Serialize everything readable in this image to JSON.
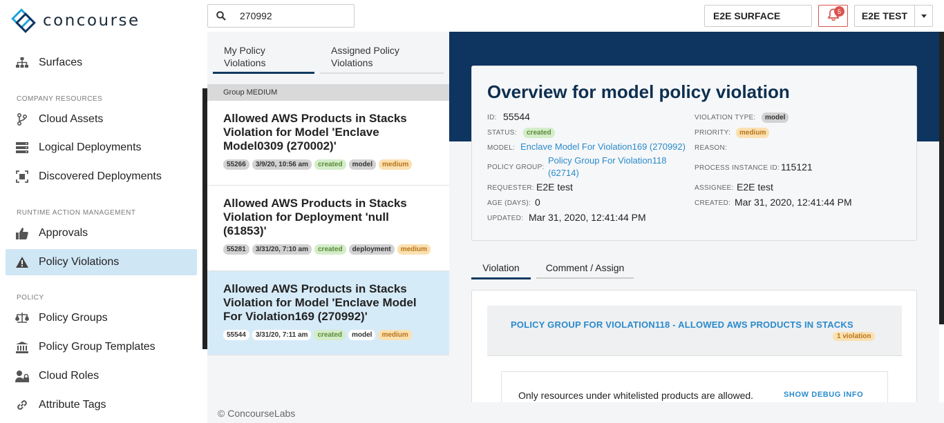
{
  "brand": {
    "name": "concourse"
  },
  "search": {
    "value": "270992",
    "icon": "search-icon"
  },
  "header": {
    "surface": "E2E SURFACE",
    "notifications": {
      "count": "5",
      "icon": "bell-icon"
    },
    "user": "E2E TEST"
  },
  "sidebar": {
    "top_item": {
      "label": "Surfaces",
      "icon": "sitemap-icon"
    },
    "sections": [
      {
        "title": "COMPANY RESOURCES",
        "items": [
          {
            "label": "Cloud Assets",
            "icon": "branch-icon"
          },
          {
            "label": "Logical Deployments",
            "icon": "server-icon"
          },
          {
            "label": "Discovered Deployments",
            "icon": "scan-icon"
          }
        ]
      },
      {
        "title": "RUNTIME ACTION MANAGEMENT",
        "items": [
          {
            "label": "Approvals",
            "icon": "thumbs-up-icon"
          },
          {
            "label": "Policy Violations",
            "icon": "warning-icon",
            "active": true
          }
        ]
      },
      {
        "title": "POLICY",
        "items": [
          {
            "label": "Policy Groups",
            "icon": "scale-icon"
          },
          {
            "label": "Policy Group Templates",
            "icon": "bank-icon"
          },
          {
            "label": "Cloud Roles",
            "icon": "user-lock-icon"
          },
          {
            "label": "Attribute Tags",
            "icon": "link-icon"
          }
        ]
      }
    ]
  },
  "list": {
    "tabs": [
      {
        "label_line1": "My Policy",
        "label_line2": "Violations",
        "active": true
      },
      {
        "label_line1": "Assigned Policy",
        "label_line2": "Violations",
        "active": false
      }
    ],
    "group_header": "Group MEDIUM",
    "cards": [
      {
        "title": "Allowed AWS Products in Stacks Violation for Model 'Enclave Model0309 (270002)'",
        "id": "55266",
        "date": "3/9/20, 10:56 am",
        "status": "created",
        "type": "model",
        "priority": "medium"
      },
      {
        "title": "Allowed AWS Products in Stacks Violation for Deployment 'null (61853)'",
        "id": "55281",
        "date": "3/31/20, 7:10 am",
        "status": "created",
        "type": "deployment",
        "priority": "medium"
      },
      {
        "title": "Allowed AWS Products in Stacks Violation for Model 'Enclave Model For Violation169 (270992)'",
        "id": "55544",
        "date": "3/31/20, 7:11 am",
        "status": "created",
        "type": "model",
        "priority": "medium",
        "selected": true
      }
    ]
  },
  "overview": {
    "title": "Overview for model policy violation",
    "labels": {
      "id": "ID:",
      "status": "STATUS:",
      "model": "MODEL:",
      "policy_group": "POLICY GROUP:",
      "requester": "REQUESTER:",
      "age": "AGE (DAYS):",
      "updated": "UPDATED:",
      "violation_type": "VIOLATION TYPE:",
      "priority": "PRIORITY:",
      "reason": "REASON:",
      "process_instance_id": "PROCESS INSTANCE ID:",
      "assignee": "ASSIGNEE:",
      "created": "CREATED:"
    },
    "values": {
      "id": "55544",
      "status": "created",
      "model": "Enclave Model For Violation169 (270992)",
      "policy_group_line1": "Policy Group For Violation118",
      "policy_group_line2": "(62714)",
      "requester": "E2E test",
      "age": "0",
      "updated": "Mar 31, 2020, 12:41:44 PM",
      "violation_type": "model",
      "priority": "medium",
      "reason": "",
      "process_instance_id": "115121",
      "assignee": "E2E test",
      "created": "Mar 31, 2020, 12:41:44 PM"
    }
  },
  "detail_tabs": [
    {
      "label": "Violation",
      "active": true
    },
    {
      "label": "Comment / Assign",
      "active": false
    }
  ],
  "violation": {
    "group_title": "POLICY GROUP FOR VIOLATION118 - ALLOWED AWS PRODUCTS IN STACKS",
    "count": "1 violation",
    "rule_text": "Only resources under whitelisted products are allowed.",
    "debug_link": "SHOW DEBUG INFO"
  },
  "footer": {
    "text": "© ConcourseLabs"
  }
}
